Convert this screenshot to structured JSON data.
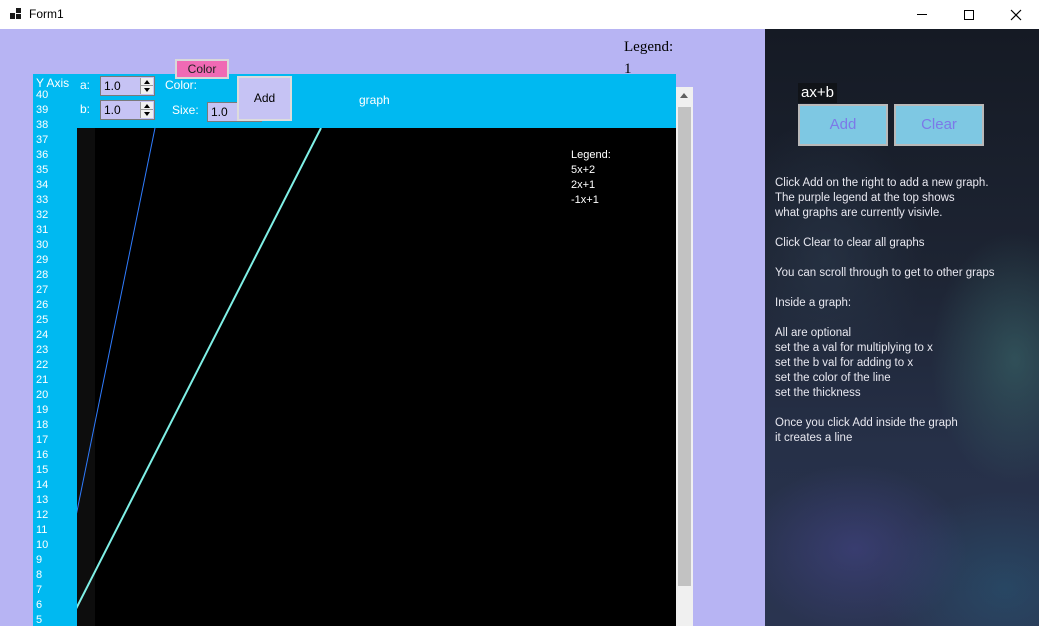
{
  "window": {
    "title": "Form1"
  },
  "legend_top": {
    "title": "Legend:",
    "count": "1"
  },
  "graph": {
    "yaxis_title": "Y Axis",
    "yaxis_ticks": [
      "40",
      "39",
      "38",
      "37",
      "36",
      "35",
      "34",
      "33",
      "32",
      "31",
      "30",
      "29",
      "28",
      "27",
      "26",
      "25",
      "24",
      "23",
      "22",
      "21",
      "20",
      "19",
      "18",
      "17",
      "16",
      "15",
      "14",
      "13",
      "12",
      "11",
      "10",
      "9",
      "8",
      "7",
      "6",
      "5"
    ],
    "a_label": "a:",
    "a_value": "1.0",
    "b_label": "b:",
    "b_value": "1.0",
    "color_label": "Color:",
    "color_button": "Color",
    "size_label": "Sixe:",
    "size_value": "1.0",
    "add_button": "Add",
    "title": "graph",
    "legend_title": "Legend:",
    "legend_items": [
      "5x+2",
      "2x+1",
      "-1x+1"
    ],
    "line_colors": [
      "#2f7cff",
      "#7ff0e6"
    ]
  },
  "right_panel": {
    "expression": "ax+b",
    "add_button": "Add",
    "clear_button": "Clear",
    "help_lines": [
      "Click Add on the right to add a new graph.",
      "The purple legend at the top shows",
      "what graphs are currently visivle.",
      "",
      "Click Clear to clear all graphs",
      "",
      "You can scroll through to get to other graps",
      "",
      "Inside a graph:",
      "",
      "All are optional",
      "set the a val for multiplying to x",
      "set the b val for adding to x",
      "set the color of the line",
      "set the thickness",
      "",
      "Once you click Add inside the graph",
      "it creates a line"
    ]
  }
}
